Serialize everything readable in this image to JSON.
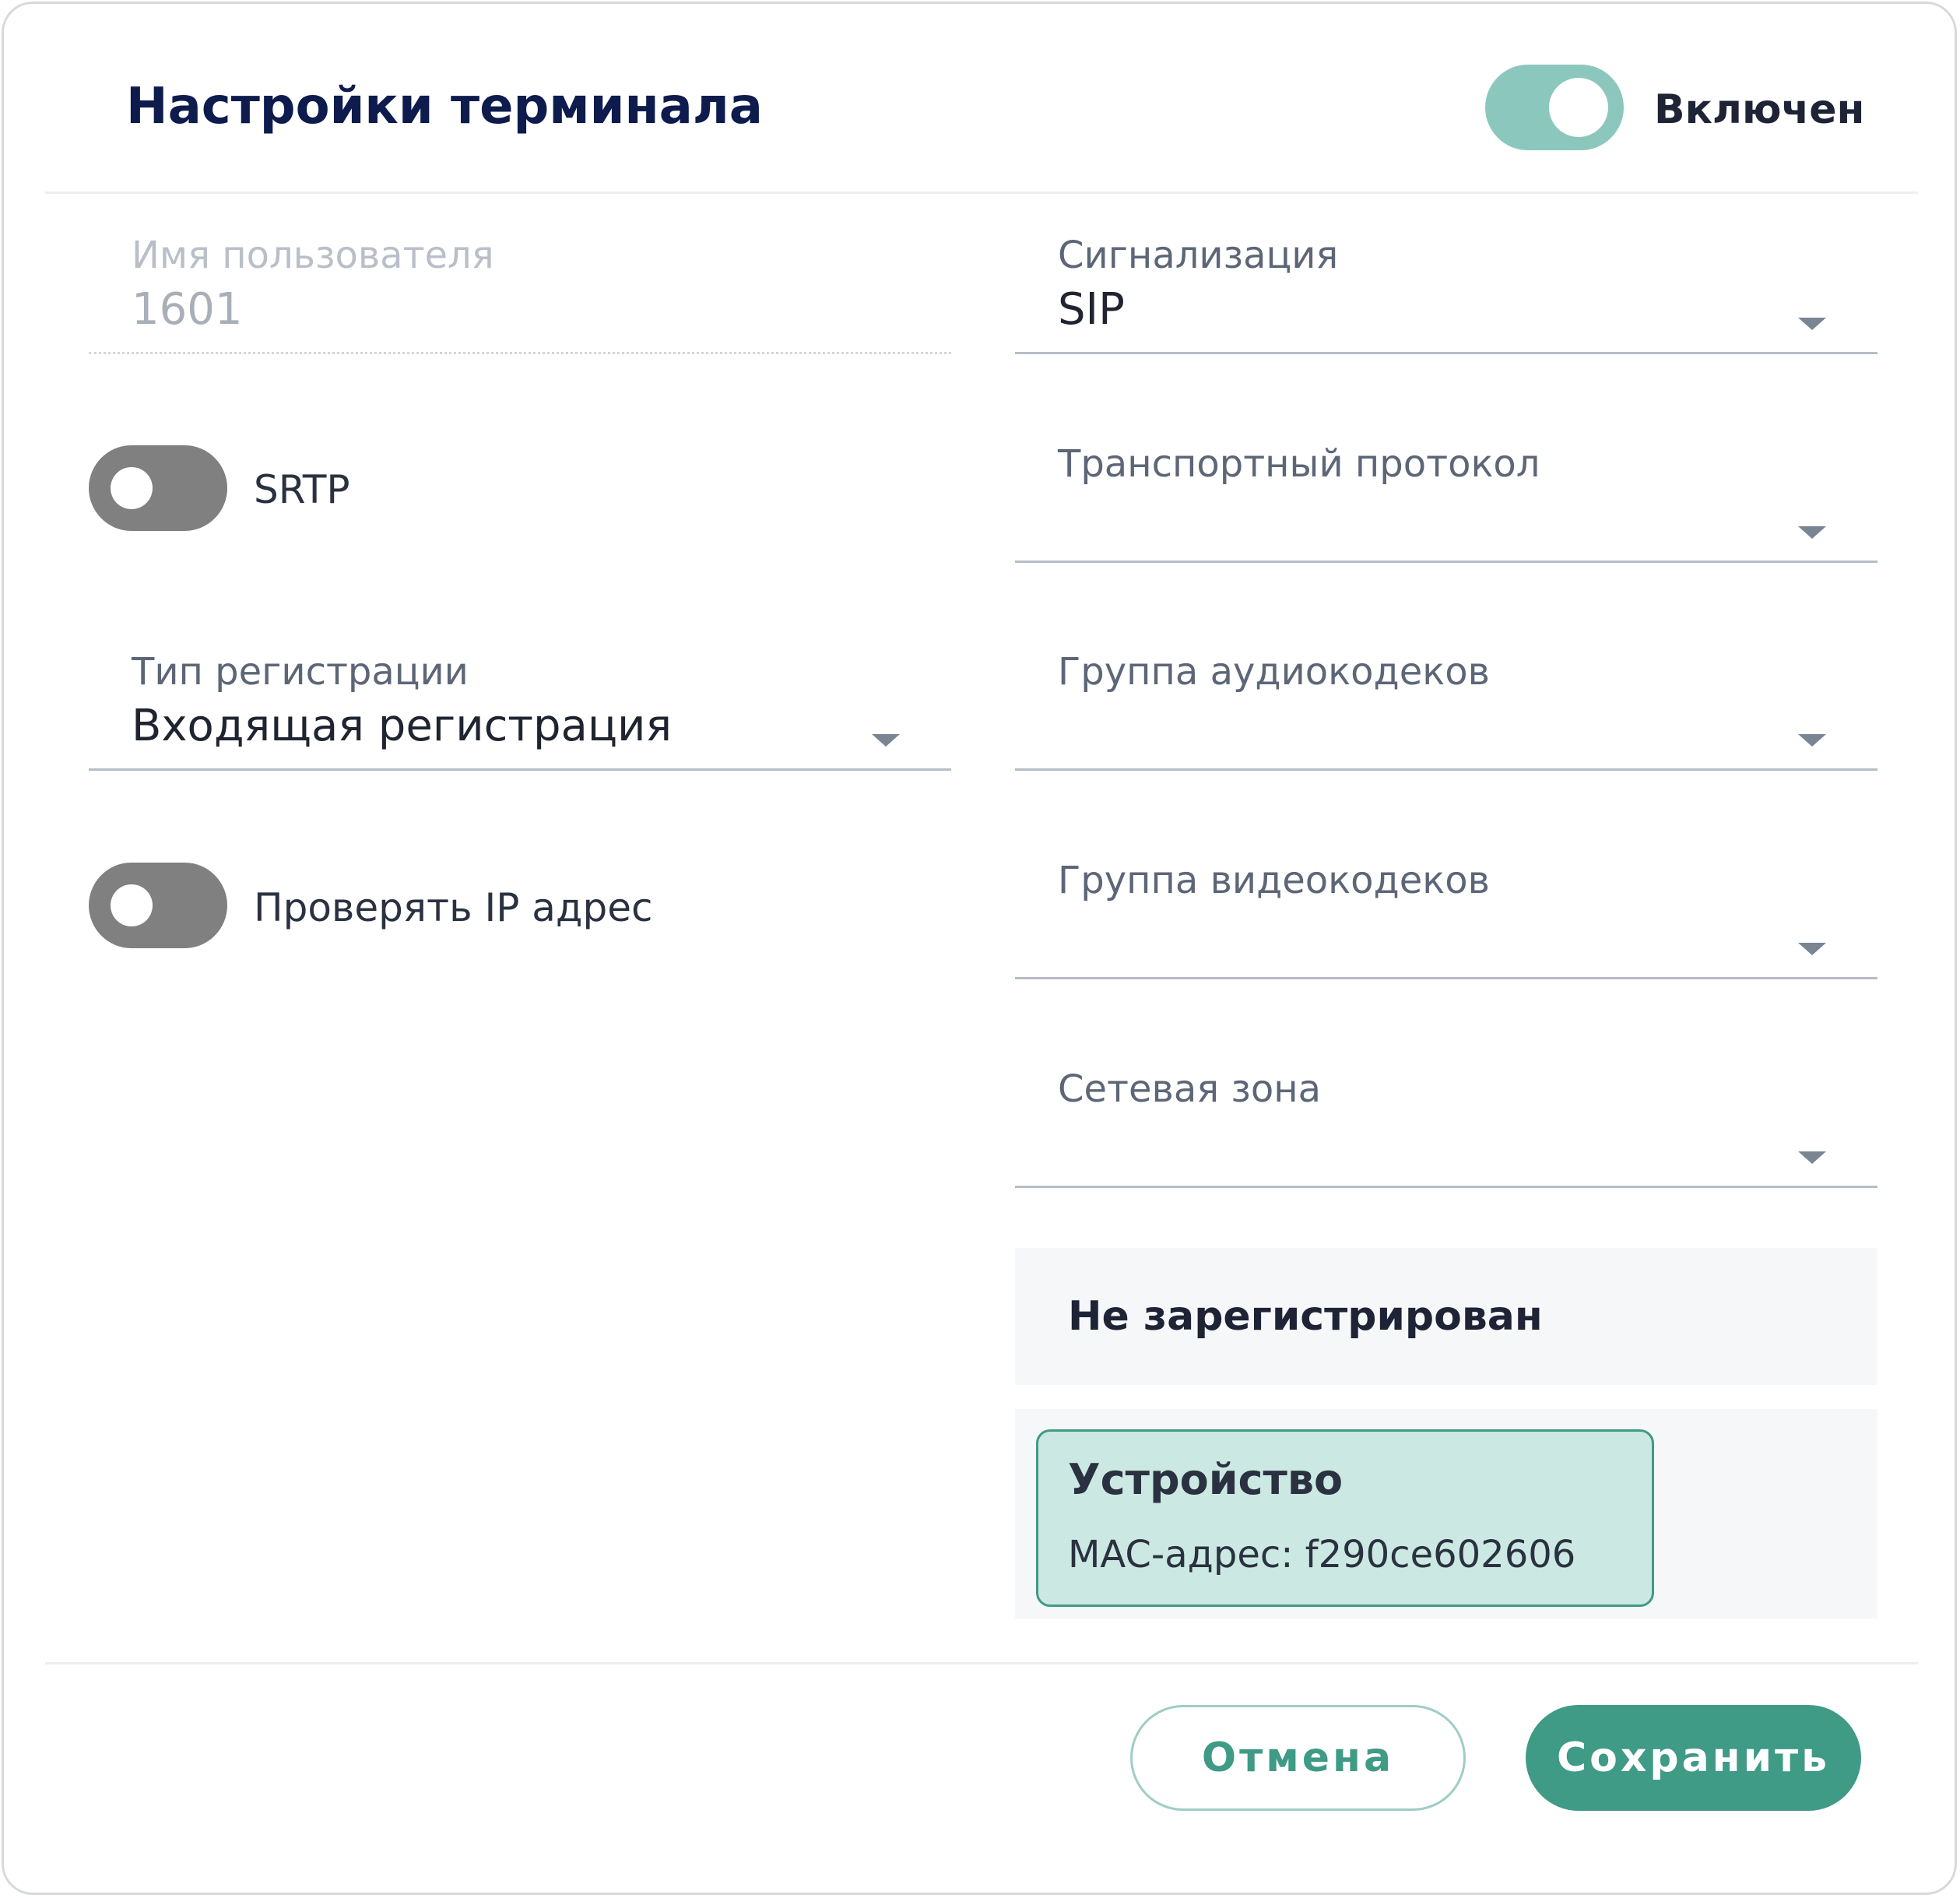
{
  "dialog": {
    "title": "Настройки терминала",
    "enabled_label": "Включен",
    "enabled": true
  },
  "left": {
    "username": {
      "label": "Имя пользователя",
      "value": "1601",
      "disabled": true
    },
    "srtp": {
      "label": "SRTP",
      "on": false
    },
    "registration_type": {
      "label": "Тип регистрации",
      "value": "Входящая регистрация"
    },
    "check_ip": {
      "label": "Проверять IP адрес",
      "on": false
    }
  },
  "right": {
    "signaling": {
      "label": "Сигнализация",
      "value": "SIP"
    },
    "transport": {
      "label": "Транспортный протокол",
      "value": ""
    },
    "audio_codecs": {
      "label": "Группа аудиокодеков",
      "value": ""
    },
    "video_codecs": {
      "label": "Группа видеокодеков",
      "value": ""
    },
    "network_zone": {
      "label": "Сетевая зона",
      "value": ""
    }
  },
  "status": {
    "registration": "Не зарегистрирован",
    "device_title": "Устройство",
    "device_mac": "MAC-адрес: f290ce602606"
  },
  "footer": {
    "cancel_label": "Отмена",
    "save_label": "Сохранить"
  },
  "colors": {
    "accent": "#3f9a86",
    "toggle_on": "#8cc7bd",
    "toggle_off": "#808080",
    "title": "#0d1b4d",
    "device_card_bg": "#cbe8e2"
  },
  "icons": {
    "dropdown": "chevron-down-icon"
  }
}
